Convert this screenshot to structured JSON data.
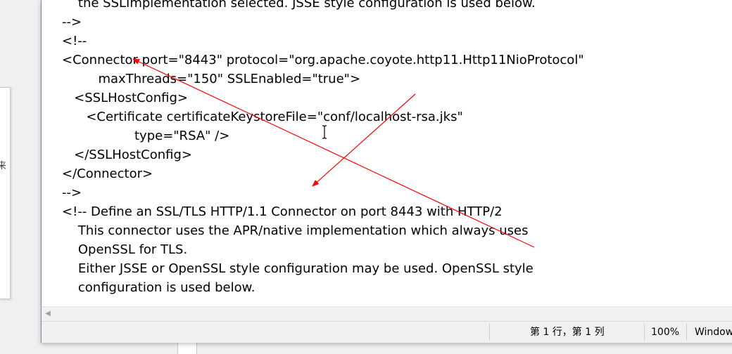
{
  "editor": {
    "lines": [
      {
        "indent": "    ",
        "text": "the SSLImplementation selected. JSSE style configuration is used below."
      },
      {
        "indent": "",
        "text": "-->"
      },
      {
        "indent": "",
        "text": "<!--"
      },
      {
        "indent": "",
        "text": "<Connector port=\"8443\" protocol=\"org.apache.coyote.http11.Http11NioProtocol\""
      },
      {
        "indent": "         ",
        "text": "maxThreads=\"150\" SSLEnabled=\"true\">"
      },
      {
        "indent": "   ",
        "text": "<SSLHostConfig>"
      },
      {
        "indent": "      ",
        "text": "<Certificate certificateKeystoreFile=\"conf/localhost-rsa.jks\""
      },
      {
        "indent": "                  ",
        "text": "type=\"RSA\" />"
      },
      {
        "indent": "   ",
        "text": "</SSLHostConfig>"
      },
      {
        "indent": "",
        "text": "</Connector>"
      },
      {
        "indent": "",
        "text": "-->"
      },
      {
        "indent": "",
        "text": "<!-- Define an SSL/TLS HTTP/1.1 Connector on port 8443 with HTTP/2"
      },
      {
        "indent": "    ",
        "text": "This connector uses the APR/native implementation which always uses"
      },
      {
        "indent": "    ",
        "text": "OpenSSL for TLS."
      },
      {
        "indent": "    ",
        "text": "Either JSSE or OpenSSL style configuration may be used. OpenSSL style"
      },
      {
        "indent": "    ",
        "text": "configuration is used below."
      }
    ]
  },
  "statusbar": {
    "position": "第 1 行，第 1 列",
    "zoom": "100%",
    "line_ending": "Windows (CRLF)"
  },
  "annotation": {
    "arrow_color": "#ff0000"
  },
  "background": {
    "glyph": "来"
  }
}
